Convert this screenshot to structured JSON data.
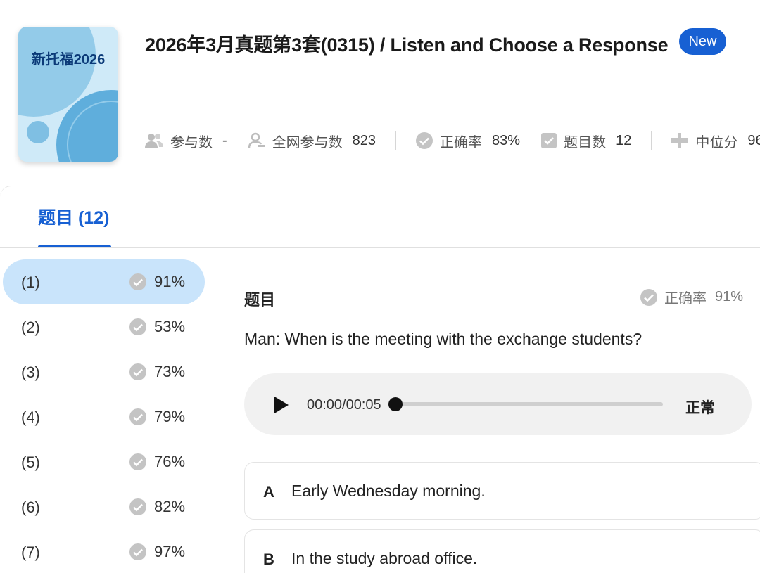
{
  "cover": {
    "text": "新托福2026"
  },
  "header": {
    "title": "2026年3月真题第3套(0315) / Listen and Choose a Response",
    "badge": "New"
  },
  "stats": [
    {
      "icon": "users-icon",
      "label": "参与数",
      "value": "-"
    },
    {
      "icon": "user-icon",
      "label": "全网参与数",
      "value": "823"
    },
    {
      "icon": "check-circle-icon",
      "label": "正确率",
      "value": "83%"
    },
    {
      "icon": "checkbox-icon",
      "label": "题目数",
      "value": "12"
    },
    {
      "icon": "median-icon",
      "label": "中位分",
      "value": "96"
    }
  ],
  "tab": {
    "label": "题目 (12)"
  },
  "questions": [
    {
      "num": "(1)",
      "pct": "91%",
      "active": true
    },
    {
      "num": "(2)",
      "pct": "53%"
    },
    {
      "num": "(3)",
      "pct": "73%"
    },
    {
      "num": "(4)",
      "pct": "79%"
    },
    {
      "num": "(5)",
      "pct": "76%"
    },
    {
      "num": "(6)",
      "pct": "82%"
    },
    {
      "num": "(7)",
      "pct": "97%"
    }
  ],
  "detail": {
    "heading": "题目",
    "rate_label": "正确率",
    "rate_value": "91%",
    "question": "Man: When is the meeting with the exchange students?",
    "player": {
      "time": "00:00/00:05",
      "speed": "正常",
      "progress": 0
    },
    "options": [
      {
        "letter": "A",
        "text": "Early Wednesday morning."
      },
      {
        "letter": "B",
        "text": "In the study abroad office."
      }
    ]
  },
  "colors": {
    "accent": "#1760d3",
    "active_row": "#c9e4fb",
    "check": "#c4c4c4"
  }
}
